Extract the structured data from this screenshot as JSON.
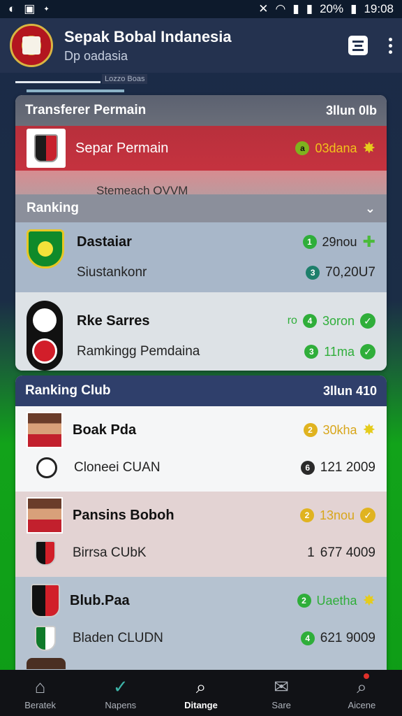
{
  "status_bar": {
    "battery": "20%",
    "time": "19:08"
  },
  "app_bar": {
    "title": "Sepak Bobal Indanesia",
    "subtitle": "Dp oadasia",
    "tab_small_label": "Lozzo Boas"
  },
  "card_transfer": {
    "header": "Transferer Permain",
    "header_right": "3llun 0lb",
    "featured": {
      "label": "Separ Permain",
      "badge_num": "a",
      "status": "03dana"
    },
    "featured_sub": "Stemeach OVVM",
    "ranking_label": "Ranking",
    "items": [
      {
        "name": "Dastaiar",
        "badge_num": "1",
        "status": "29nou",
        "sub": "Siustankonr",
        "sub_badge": "3",
        "sub_value": "70,20U7"
      },
      {
        "name": "Rke Sarres",
        "badge_num": "4",
        "status": "3oron",
        "prefix": "ro",
        "sub": "Ramkingg Pemdaina",
        "sub_badge": "3",
        "sub_value": "11ma"
      }
    ]
  },
  "card_club": {
    "header": "Ranking Club",
    "header_right": "3llun 410",
    "items": [
      {
        "name": "Boak Pda",
        "badge_num": "2",
        "status": "30kha",
        "sub": "Cloneei CUAN",
        "sub_badge": "6",
        "sub_value": "121 2009"
      },
      {
        "name": "Pansins Boboh",
        "badge_num": "2",
        "status": "13nou",
        "sub": "Birrsa CUbK",
        "sub_badge": "1",
        "sub_value": "677 4009"
      },
      {
        "name": "Blub.Paa",
        "badge_num": "2",
        "status": "Uaetha",
        "sub": "Bladen CLUDN",
        "sub_badge": "4",
        "sub_value": "621 9009"
      }
    ]
  },
  "bottom_nav": [
    {
      "label": "Beratek",
      "icon": "home-icon"
    },
    {
      "label": "Napens",
      "icon": "check-circle-icon"
    },
    {
      "label": "Ditange",
      "icon": "search-icon"
    },
    {
      "label": "Sare",
      "icon": "mail-icon"
    },
    {
      "label": "Aicene",
      "icon": "profile-search-icon"
    }
  ]
}
